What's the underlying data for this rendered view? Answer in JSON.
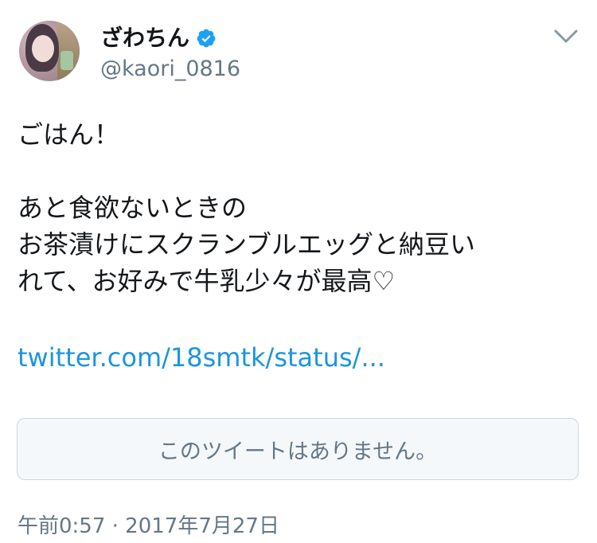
{
  "user": {
    "display_name": "ざわちん",
    "handle": "@kaori_0816",
    "verified": true
  },
  "tweet": {
    "lines": [
      "ごはん！",
      "",
      "あと食欲ないときの",
      "お茶漬けにスクランブルエッグと納豆い",
      "れて、お好みで牛乳少々が最高♡"
    ],
    "link_text": "twitter.com/18smtk/status/...",
    "quoted_unavailable": "このツイートはありません。",
    "timestamp": "午前0:57 · 2017年7月27日"
  },
  "icons": {
    "verified": "verified-badge-icon",
    "menu": "chevron-down-icon"
  },
  "colors": {
    "link": "#1b95e0",
    "verified": "#1da1f2",
    "secondary_text": "#657786",
    "border": "#ccd6dd"
  }
}
